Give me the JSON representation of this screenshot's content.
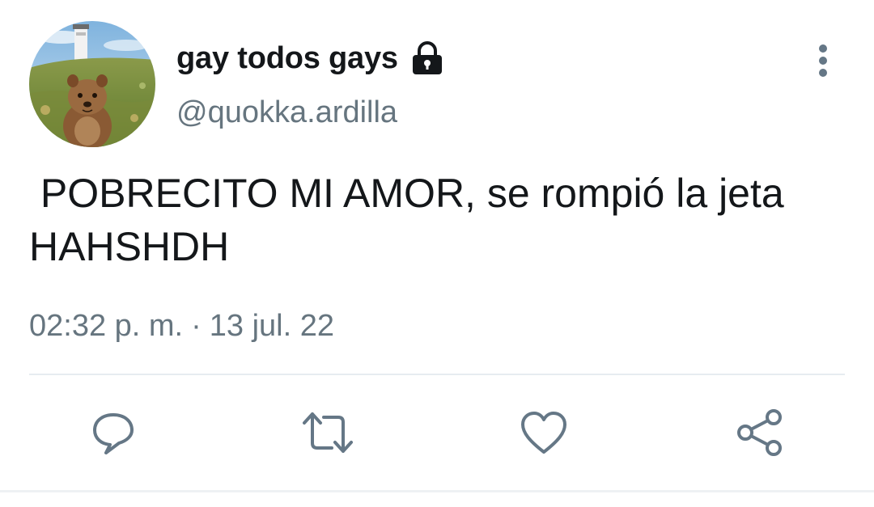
{
  "user": {
    "display_name": "gay todos gays",
    "handle": "@quokka.ardilla",
    "protected_icon": "lock-icon",
    "avatar": "quokka-photo-avatar"
  },
  "tweet": {
    "text": " POBRECITO MI AMOR, se rompió la jeta HAHSHDH",
    "time": "02:32 p. m.",
    "separator": "·",
    "date": "13 jul. 22"
  },
  "actions": {
    "reply_icon": "reply-icon",
    "retweet_icon": "retweet-icon",
    "like_icon": "heart-icon",
    "share_icon": "share-icon",
    "more_icon": "more-vertical-icon"
  },
  "colors": {
    "text_primary": "#14171a",
    "text_secondary": "#66757f",
    "icon_color": "#657786",
    "divider": "#e6ecf0"
  }
}
